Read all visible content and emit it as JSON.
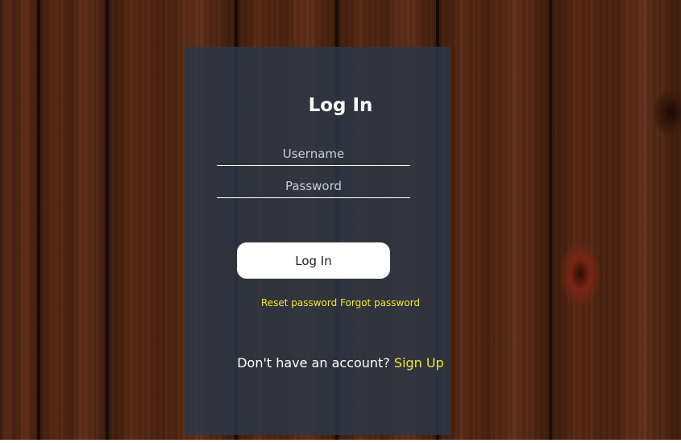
{
  "login_form": {
    "title": "Log In",
    "username_placeholder": "Username",
    "password_placeholder": "Password",
    "submit_label": "Log In",
    "reset_password_link": "Reset password",
    "forgot_password_link": "Forgot password",
    "no_account_text": "Don't have an account?",
    "signup_link": "Sign Up"
  },
  "colors": {
    "card_background": "#2c3746",
    "link_accent": "#f0e62a",
    "button_background": "#ffffff",
    "wood": "#4a2413"
  }
}
